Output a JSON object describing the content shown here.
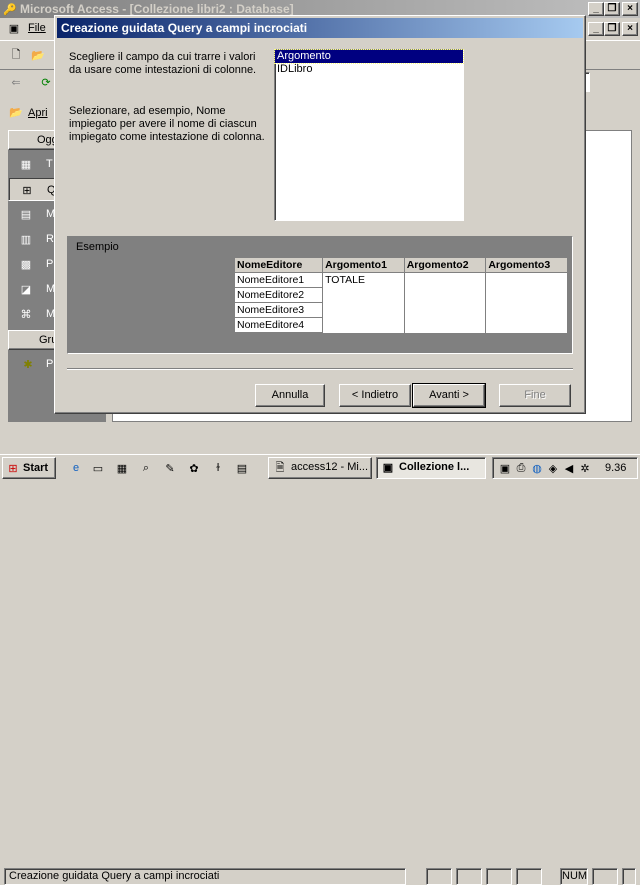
{
  "app": {
    "title": "Microsoft Access - [Collezione libri2 : Database]",
    "menu_file": "File"
  },
  "db_window": {
    "open_label": "Apri",
    "objects_header": "Ogg",
    "groups_header": "Gru",
    "nav_items": [
      {
        "icon": "table-icon",
        "label": "T"
      },
      {
        "icon": "query-icon",
        "label": "Q"
      },
      {
        "icon": "form-icon",
        "label": "M"
      },
      {
        "icon": "report-icon",
        "label": "R"
      },
      {
        "icon": "page-icon",
        "label": "P"
      },
      {
        "icon": "macro-icon",
        "label": "M"
      },
      {
        "icon": "module-icon",
        "label": "M"
      }
    ],
    "group_item": {
      "icon": "favorites-icon",
      "label": "P"
    }
  },
  "dialog": {
    "title": "Creazione guidata Query a campi incrociati",
    "instruction": "Scegliere il campo da cui trarre i valori da usare come intestazioni di colonne.",
    "example_text": "Selezionare, ad esempio, Nome impiegato per avere il nome di ciascun impiegato come intestazione di colonna.",
    "fields": [
      "Argomento",
      "IDLibro"
    ],
    "selected_field": "Argomento",
    "sample_label": "Esempio",
    "sample_headers": [
      "NomeEditore",
      "Argomento1",
      "Argomento2",
      "Argomento3"
    ],
    "sample_rows": [
      [
        "NomeEditore1",
        "TOTALE",
        "",
        ""
      ],
      [
        "NomeEditore2",
        "",
        "",
        ""
      ],
      [
        "NomeEditore3",
        "",
        "",
        ""
      ],
      [
        "NomeEditore4",
        "",
        "",
        ""
      ]
    ],
    "buttons": {
      "cancel": "Annulla",
      "back": "< Indietro",
      "next": "Avanti >",
      "finish": "Fine"
    }
  },
  "statusbar": {
    "text": "Creazione guidata Query a campi incrociati",
    "num": "NUM"
  },
  "taskbar": {
    "start": "Start",
    "tasks": [
      {
        "label": "access12 - Mi...",
        "active": false
      },
      {
        "label": "Collezione l...",
        "active": true
      }
    ],
    "clock": "9.36"
  },
  "colors": {
    "face": "#d4d0c8",
    "title_active": "#0a246a",
    "selection": "#000080"
  }
}
